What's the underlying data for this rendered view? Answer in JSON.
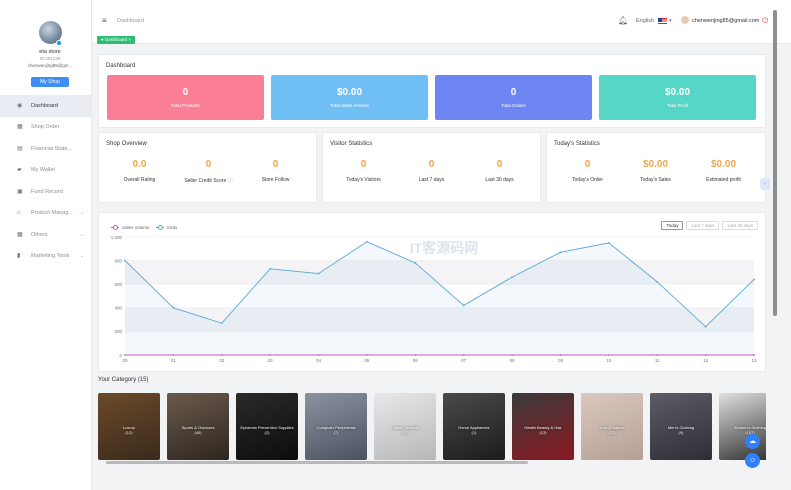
{
  "sidebar": {
    "store_name": "eta store",
    "store_id": "ID:481239",
    "store_email": "chenwenjing85@gm...",
    "my_shop_label": "My Shop",
    "items": [
      {
        "label": "Dashboard",
        "icon": "dashboard-icon",
        "active": true
      },
      {
        "label": "Shop Order",
        "icon": "order-icon"
      },
      {
        "label": "Financial State...",
        "icon": "financial-icon"
      },
      {
        "label": "My Wallet",
        "icon": "wallet-icon"
      },
      {
        "label": "Fund Record",
        "icon": "record-icon"
      },
      {
        "label": "Product Manag...",
        "icon": "product-icon",
        "expandable": true
      },
      {
        "label": "Others",
        "icon": "grid-icon",
        "expandable": true
      },
      {
        "label": "Marketing Tools",
        "icon": "chart-icon",
        "expandable": true
      }
    ]
  },
  "topbar": {
    "breadcrumb": "Dashboard",
    "tag": "Dashboard",
    "language": "English",
    "user_email": "chenwenjing85@gmail.com"
  },
  "dashboard": {
    "title": "Dashboard",
    "tiles": [
      {
        "value": "0",
        "label": "Total Products",
        "color": "#fa7f96"
      },
      {
        "value": "$0.00",
        "label": "Total Sales Amount",
        "color": "#6fbff5"
      },
      {
        "value": "0",
        "label": "Total Orders",
        "color": "#6e86f3"
      },
      {
        "value": "$0.00",
        "label": "Total Profit",
        "color": "#55d6c6"
      }
    ]
  },
  "shop_overview": {
    "title": "Shop Overview",
    "items": [
      {
        "value": "0.0",
        "label": "Overall Rating"
      },
      {
        "value": "0",
        "label": "Seller Credit Score"
      },
      {
        "value": "0",
        "label": "Store Follow"
      }
    ]
  },
  "visitor_statistics": {
    "title": "Visitor Statistics",
    "items": [
      {
        "value": "0",
        "label": "Today's Visitors"
      },
      {
        "value": "0",
        "label": "Last 7 days"
      },
      {
        "value": "0",
        "label": "Last 30 days"
      }
    ]
  },
  "todays_statistics": {
    "title": "Today's Statistics",
    "items": [
      {
        "value": "0",
        "label": "Today's Order"
      },
      {
        "value": "$0.00",
        "label": "Today's Sales"
      },
      {
        "value": "$0.00",
        "label": "Estimated profit"
      }
    ]
  },
  "chart_controls": {
    "range_buttons": [
      "Today",
      "Last 7 days",
      "Last 30 days"
    ],
    "active_range": "Today"
  },
  "chart_data": {
    "type": "line",
    "x": [
      "00",
      "01",
      "02",
      "03",
      "04",
      "05",
      "06",
      "07",
      "08",
      "09",
      "10",
      "11",
      "12",
      "13"
    ],
    "series": [
      {
        "name": "Sales Volume",
        "color": "#d94fc4",
        "values": [
          0,
          0,
          0,
          0,
          0,
          0,
          0,
          0,
          0,
          0,
          0,
          0,
          0,
          0
        ]
      },
      {
        "name": "Visits",
        "color": "#5aa7d6",
        "values": [
          800,
          400,
          270,
          730,
          690,
          960,
          780,
          420,
          660,
          870,
          950,
          620,
          240,
          640
        ]
      }
    ],
    "yticks": [
      "0",
      "200",
      "400",
      "600",
      "800",
      "1,000"
    ],
    "ylim": [
      0,
      1000
    ],
    "grid": true,
    "legend": "top-left"
  },
  "watermark": "IT客源码网",
  "categories": {
    "title": "Your Category",
    "count": "(15)",
    "items": [
      {
        "name": "Luxury",
        "count": "(12)",
        "colors": [
          "#6b4a2b",
          "#3a2a1a"
        ]
      },
      {
        "name": "Sports & Outdoors",
        "count": "(40)",
        "colors": [
          "#6b5a4c",
          "#2d2620"
        ]
      },
      {
        "name": "Epidemic Prevention Supplies",
        "count": "(2)",
        "colors": [
          "#2a2a2a",
          "#0d0d0d"
        ]
      },
      {
        "name": "Computer Peripherals",
        "count": "(7)",
        "colors": [
          "#8c93a0",
          "#4a5260"
        ]
      },
      {
        "name": "Digital Products",
        "count": "(37)",
        "colors": [
          "#e8e8e8",
          "#b7b7b7"
        ]
      },
      {
        "name": "Home Appliances",
        "count": "(1)",
        "colors": [
          "#4a4a4a",
          "#1c1c1c"
        ]
      },
      {
        "name": "Health Beauty & Hair",
        "count": "(13)",
        "colors": [
          "#3a3a3a",
          "#8a1a22"
        ]
      },
      {
        "name": "Kids & Babies",
        "count": "(22)",
        "colors": [
          "#dac9c0",
          "#b5a095"
        ]
      },
      {
        "name": "Men's Clothing",
        "count": "(9)",
        "colors": [
          "#5c5c66",
          "#2e2e36"
        ]
      },
      {
        "name": "Women's Clothing",
        "count": "(157)",
        "colors": [
          "#e0e0e0",
          "#2a2a2a"
        ]
      }
    ]
  }
}
